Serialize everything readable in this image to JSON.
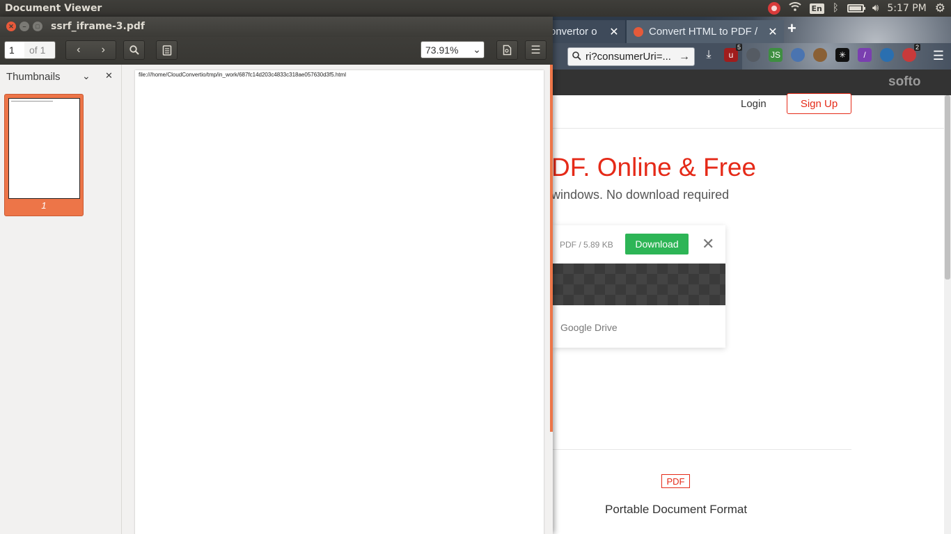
{
  "panel": {
    "app_title": "Document Viewer",
    "keyboard_layout": "En",
    "clock": "5:17 PM",
    "icons": [
      "red-indicator-icon",
      "wifi-icon",
      "keyboard-icon",
      "bluetooth-icon",
      "battery-icon",
      "volume-icon",
      "gear-icon"
    ]
  },
  "browser": {
    "tabs": [
      {
        "label": "onvertor o",
        "active": false
      },
      {
        "label": "Convert HTML to PDF /",
        "active": true
      }
    ],
    "url": "ri?consumerUri=...",
    "extensions": [
      {
        "name": "ublock-icon",
        "badge": "5",
        "color": "#a01d1d"
      },
      {
        "name": "extension-icon-grey",
        "badge": "",
        "color": "#555b63"
      },
      {
        "name": "js-icon",
        "badge": "",
        "color": "#3e8e41"
      },
      {
        "name": "globe-icon",
        "badge": "",
        "color": "#4a74b0"
      },
      {
        "name": "cookie-icon",
        "badge": "",
        "color": "#8a6035"
      },
      {
        "name": "spark-icon",
        "badge": "",
        "color": "#111111"
      },
      {
        "name": "pen-icon",
        "badge": "",
        "color": "#7a3fb0"
      },
      {
        "name": "earth-icon",
        "badge": "",
        "color": "#2a6fb0"
      },
      {
        "name": "share-icon",
        "badge": "2",
        "color": "#c83a3a"
      }
    ],
    "site": {
      "logo": "softo",
      "login": "Login",
      "signup": "Sign Up",
      "hero_title": "DF. Online & Free",
      "hero_sub": "windows. No download required",
      "card_meta": "PDF / 5.89 KB",
      "download": "Download",
      "gdrive": "Google Drive",
      "pdf_badge": "PDF",
      "format_name": "Portable Document Format"
    }
  },
  "viewer": {
    "filename": "ssrf_iframe-3.pdf",
    "page_current": "1",
    "page_total": "of 1",
    "zoom": "73.91%",
    "sidebar_title": "Thumbnails",
    "thumbnail_label": "1",
    "page_text": "file:///home/CloudConvertio/tmp/in_work/687fc14d203c4833c318ae057630d3f5.html"
  }
}
